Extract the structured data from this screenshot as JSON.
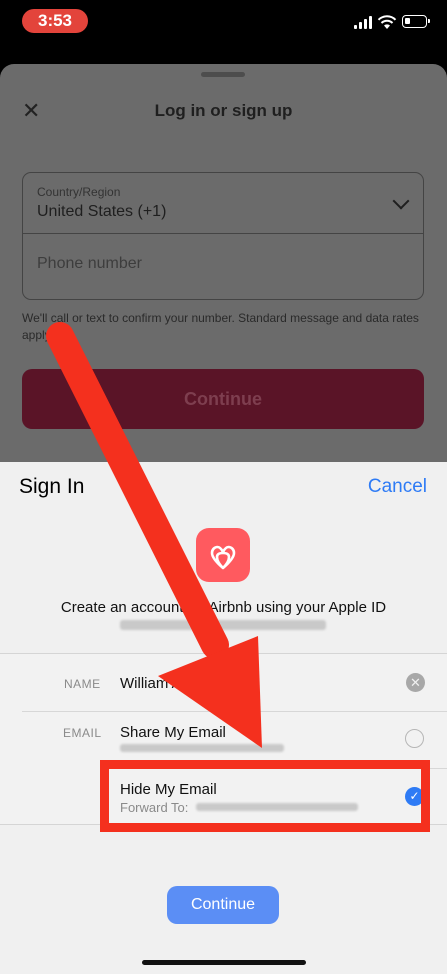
{
  "status": {
    "time": "3:53"
  },
  "airbnb": {
    "title": "Log in or sign up",
    "close_icon": "close-icon",
    "country_label": "Country/Region",
    "country_value": "United States (+1)",
    "phone_placeholder": "Phone number",
    "disclaimer": "We'll call or text to confirm your number. Standard message and data rates apply.",
    "continue_label": "Continue"
  },
  "apple": {
    "title": "Sign In",
    "cancel_label": "Cancel",
    "app_icon": "airbnb-logo-icon",
    "create_text": "Create an account for Airbnb using your Apple ID",
    "name_label": "NAME",
    "name_value": "William Ant",
    "email_label": "EMAIL",
    "share_label": "Share My Email",
    "hide_label": "Hide My Email",
    "forward_label": "Forward To:",
    "continue_label": "Continue"
  },
  "colors": {
    "airbnb_accent": "#ff5a5f",
    "apple_blue": "#2e7bf5",
    "annotation_red": "#f4301e"
  }
}
